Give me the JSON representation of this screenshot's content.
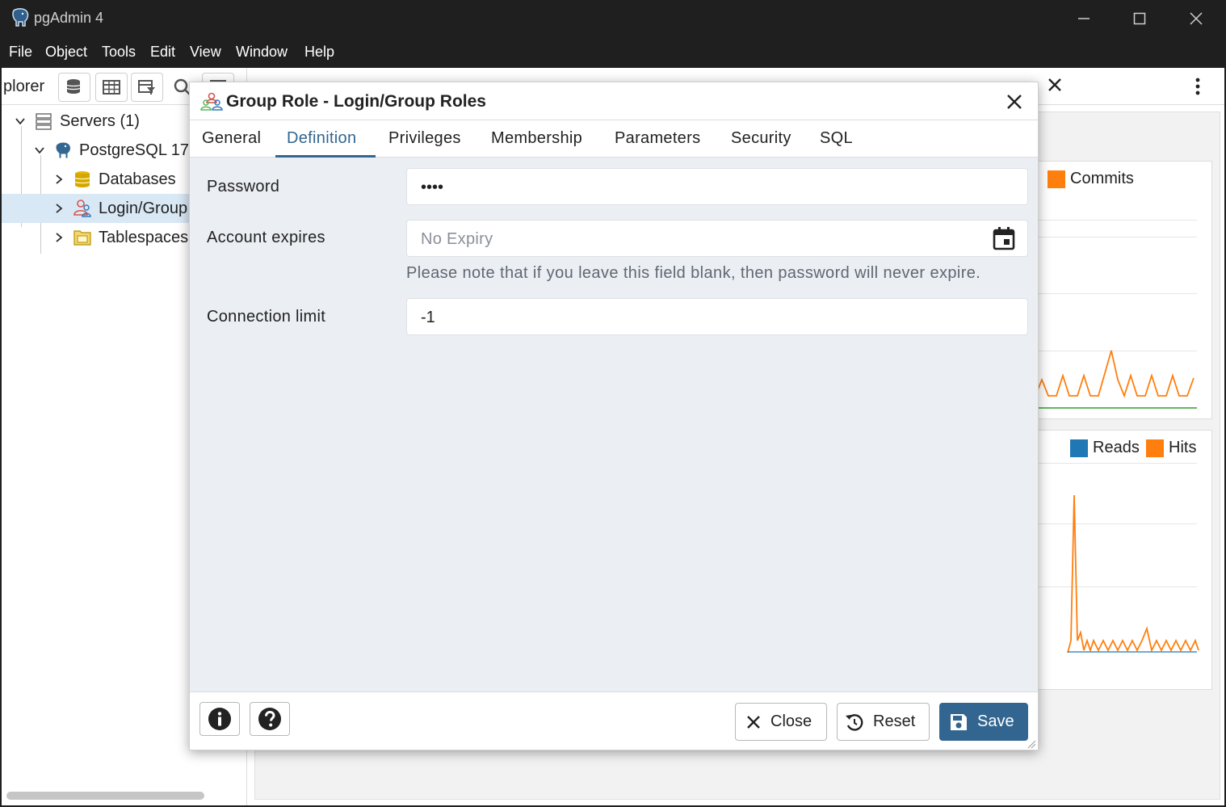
{
  "window": {
    "title": "pgAdmin 4"
  },
  "menu": [
    "File",
    "Object",
    "Tools",
    "Edit",
    "View",
    "Window",
    "Help"
  ],
  "left_panel": {
    "title": "plorer",
    "tree": [
      {
        "label": "Servers (1)",
        "icon": "servers-icon",
        "expanded": true
      },
      {
        "label": "PostgreSQL 17",
        "icon": "postgres-elephant-icon",
        "expanded": true
      },
      {
        "label": "Databases",
        "icon": "databases-icon",
        "expanded": false
      },
      {
        "label": "Login/Group",
        "icon": "login-group-roles-icon",
        "expanded": false,
        "selected": true
      },
      {
        "label": "Tablespaces",
        "icon": "tablespaces-icon",
        "expanded": false
      }
    ]
  },
  "dashboard": {
    "legend_top": [
      {
        "label": "Commits",
        "color": "#ff7f0e"
      }
    ],
    "legend_top_partial": "s",
    "legend_bottom": [
      {
        "label": "Reads",
        "color": "#1f77b4"
      },
      {
        "label": "Hits",
        "color": "#ff7f0e"
      }
    ]
  },
  "dialog": {
    "title": "Group Role - Login/Group Roles",
    "tabs": [
      "General",
      "Definition",
      "Privileges",
      "Membership",
      "Parameters",
      "Security",
      "SQL"
    ],
    "active_tab": "Definition",
    "fields": {
      "password": {
        "label": "Password",
        "value": "••••"
      },
      "account_expires": {
        "label": "Account expires",
        "placeholder": "No Expiry",
        "help": "Please note that if you leave this field blank, then password will never expire."
      },
      "connection_limit": {
        "label": "Connection limit",
        "value": "-1"
      }
    },
    "footer": {
      "close_label": "Close",
      "reset_label": "Reset",
      "save_label": "Save"
    }
  },
  "colors": {
    "accent": "#326690",
    "selected_row": "#d9e8f5",
    "chart_orange": "#ff7f0e",
    "chart_blue": "#1f77b4",
    "chart_green": "#2ca02c"
  }
}
